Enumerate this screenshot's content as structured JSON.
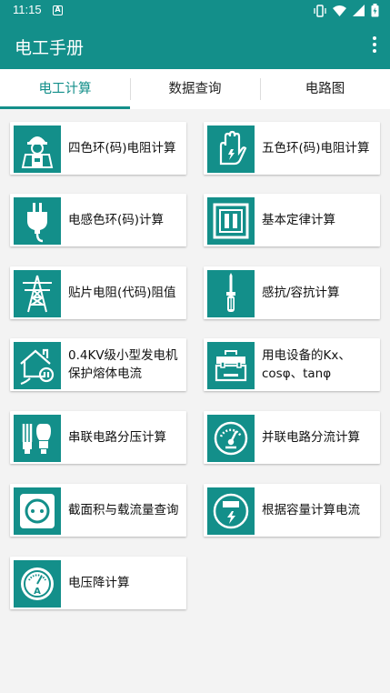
{
  "status_bar": {
    "time": "11:15",
    "notification_icon": "a-letter-icon",
    "system_icons": [
      "vibrate-icon",
      "wifi-icon",
      "signal-icon",
      "battery-icon"
    ]
  },
  "app_bar": {
    "title": "电工手册",
    "menu_icon": "more-vert-icon"
  },
  "tabs": [
    {
      "label": "电工计算",
      "active": true
    },
    {
      "label": "数据查询",
      "active": false
    },
    {
      "label": "电路图",
      "active": false
    }
  ],
  "colors": {
    "primary": "#138f8a",
    "background": "#f3f3f3",
    "card": "#ffffff"
  },
  "cards": [
    {
      "label": "四色环(码)电阻计算",
      "icon": "electrician-icon"
    },
    {
      "label": "五色环(码)电阻计算",
      "icon": "insulating-glove-icon"
    },
    {
      "label": "电感色环(码)计算",
      "icon": "power-plug-icon"
    },
    {
      "label": "基本定律计算",
      "icon": "switch-panel-icon"
    },
    {
      "label": "贴片电阻(代码)阻值",
      "icon": "power-tower-icon"
    },
    {
      "label": "感抗/容抗计算",
      "icon": "screwdriver-icon"
    },
    {
      "label": "0.4KV级小型发电机保护熔体电流",
      "icon": "house-plug-icon"
    },
    {
      "label": "用电设备的Kx、cosφ、tanφ",
      "icon": "toolbox-icon"
    },
    {
      "label": "串联电路分压计算",
      "icon": "bulb-icon"
    },
    {
      "label": "并联电路分流计算",
      "icon": "meter-gauge-icon"
    },
    {
      "label": "截面积与载流量查询",
      "icon": "wall-socket-icon"
    },
    {
      "label": "根据容量计算电流",
      "icon": "electric-meter-icon"
    },
    {
      "label": "电压降计算",
      "icon": "ammeter-icon"
    }
  ]
}
